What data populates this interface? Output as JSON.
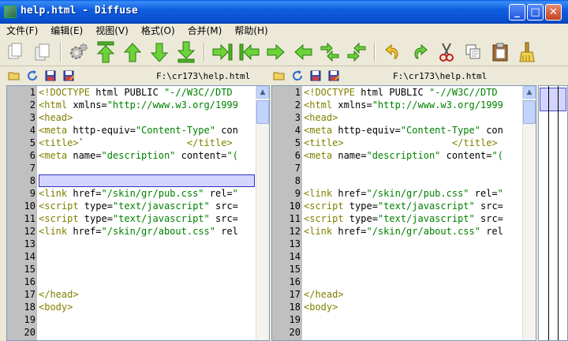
{
  "window": {
    "title": "help.html - Diffuse"
  },
  "titlebar_buttons": {
    "minimize": "_",
    "maximize": "□",
    "close": "✕"
  },
  "menu": [
    "文件(F)",
    "编辑(E)",
    "视图(V)",
    "格式(O)",
    "合并(M)",
    "帮助(H)"
  ],
  "toolbar": [
    "new-tab-icon",
    "new-window-icon",
    "preferences-gear-icon",
    "first-difference-icon",
    "previous-difference-icon",
    "next-difference-icon",
    "last-difference-icon",
    "merge-from-left-icon",
    "merge-from-right-icon",
    "copy-right-icon",
    "copy-left-icon",
    "merge-left-then-right-icon",
    "merge-right-then-left-icon",
    "undo-icon",
    "redo-icon",
    "cut-icon",
    "copy-icon",
    "paste-icon",
    "clear-edits-icon"
  ],
  "left": {
    "path": "F:\\cr173\\help.html",
    "lines": [
      {
        "n": "1",
        "text": "<!DOCTYPE html PUBLIC \"-//W3C//DTD"
      },
      {
        "n": "2",
        "text": "<html xmlns=\"http://www.w3.org/1999"
      },
      {
        "n": "3",
        "text": "<head>"
      },
      {
        "n": "4",
        "text": "<meta http-equiv=\"Content-Type\" con"
      },
      {
        "n": "5",
        "text": "<title>`                  </title>"
      },
      {
        "n": "6",
        "text": "<meta name=\"description\" content=\"("
      },
      {
        "n": "7",
        "text": ""
      },
      {
        "n": "8",
        "text": ""
      },
      {
        "n": "9",
        "text": "<link href=\"/skin/gr/pub.css\" rel=\""
      },
      {
        "n": "10",
        "text": "<script type=\"text/javascript\" src="
      },
      {
        "n": "11",
        "text": "<script type=\"text/javascript\" src="
      },
      {
        "n": "12",
        "text": "<link href=\"/skin/gr/about.css\" rel"
      },
      {
        "n": "13",
        "text": ""
      },
      {
        "n": "14",
        "text": ""
      },
      {
        "n": "15",
        "text": ""
      },
      {
        "n": "16",
        "text": ""
      },
      {
        "n": "17",
        "text": "</head>"
      },
      {
        "n": "18",
        "text": "<body>"
      },
      {
        "n": "19",
        "text": ""
      },
      {
        "n": "20",
        "text": ""
      }
    ]
  },
  "right": {
    "path": "F:\\cr173\\help.html",
    "lines": [
      {
        "n": "1",
        "text": "<!DOCTYPE html PUBLIC \"-//W3C//DTD"
      },
      {
        "n": "2",
        "text": "<html xmlns=\"http://www.w3.org/1999"
      },
      {
        "n": "3",
        "text": "<head>"
      },
      {
        "n": "4",
        "text": "<meta http-equiv=\"Content-Type\" con"
      },
      {
        "n": "5",
        "text": "<title>                   </title>"
      },
      {
        "n": "6",
        "text": "<meta name=\"description\" content=\"("
      },
      {
        "n": "7",
        "text": ""
      },
      {
        "n": "8",
        "text": ""
      },
      {
        "n": "9",
        "text": "<link href=\"/skin/gr/pub.css\" rel=\""
      },
      {
        "n": "10",
        "text": "<script type=\"text/javascript\" src="
      },
      {
        "n": "11",
        "text": "<script type=\"text/javascript\" src="
      },
      {
        "n": "12",
        "text": "<link href=\"/skin/gr/about.css\" rel"
      },
      {
        "n": "13",
        "text": ""
      },
      {
        "n": "14",
        "text": ""
      },
      {
        "n": "15",
        "text": ""
      },
      {
        "n": "16",
        "text": ""
      },
      {
        "n": "17",
        "text": "</head>"
      },
      {
        "n": "18",
        "text": "<body>"
      },
      {
        "n": "19",
        "text": ""
      },
      {
        "n": "20",
        "text": ""
      }
    ]
  },
  "highlighted_line": "8",
  "colors": {
    "tag": "#808000",
    "string": "#008000",
    "gutter": "#c0c0c0",
    "highlight": "#d4d4ff",
    "highlight_border": "#2f2fbf"
  }
}
